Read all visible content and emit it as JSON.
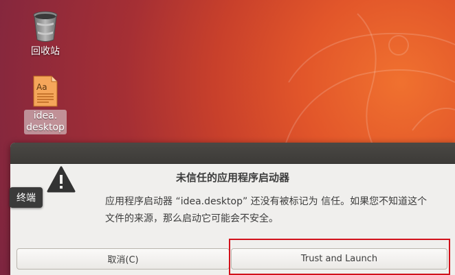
{
  "desktop": {
    "icons": [
      {
        "label": "回收站",
        "icon": "trash-icon"
      },
      {
        "label": "idea.\ndesktop",
        "icon": "text-file-icon"
      }
    ],
    "file_glyph": "Aa"
  },
  "dialog": {
    "title": "未信任的应用程序启动器",
    "body": "应用程序启动器 “idea.desktop” 还没有被标记为 信任。如果您不知道这个文件的来源，那么启动它可能会不安全。",
    "icon": "warning-icon",
    "buttons": {
      "cancel": "取消(C)",
      "trust": "Trust and Launch"
    },
    "accent_color": "#d2101a"
  },
  "tooltip": {
    "text": "终端"
  }
}
